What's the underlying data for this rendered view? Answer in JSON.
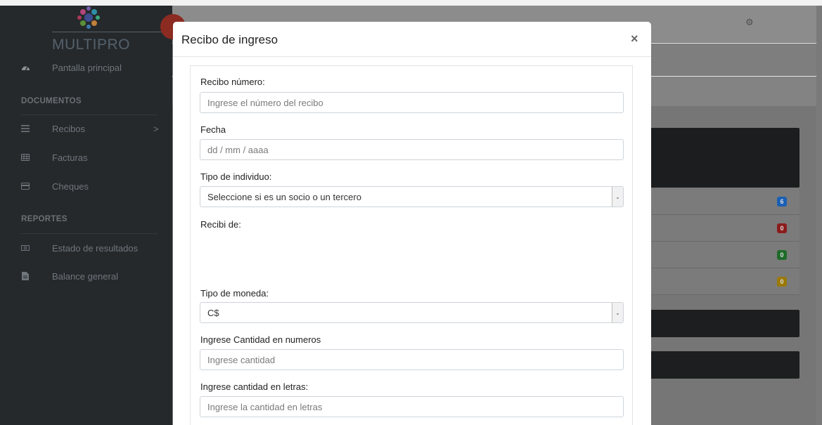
{
  "app": {
    "brand_name": "MULTIPRO"
  },
  "sidebar": {
    "home": {
      "label": "Pantalla principal",
      "icon": "dashboard-icon"
    },
    "sections": [
      {
        "title": "DOCUMENTOS",
        "items": [
          {
            "label": "Recibos",
            "icon": "list-icon",
            "chevron": ">"
          },
          {
            "label": "Facturas",
            "icon": "table-icon"
          },
          {
            "label": "Cheques",
            "icon": "credit-card-icon"
          }
        ]
      },
      {
        "title": "REPORTES",
        "items": [
          {
            "label": "Estado de resultados",
            "icon": "money-icon"
          },
          {
            "label": "Balance general",
            "icon": "file-icon"
          }
        ]
      }
    ]
  },
  "background": {
    "badges": [
      {
        "value": "6",
        "color": "#1a5fb4"
      },
      {
        "value": "0",
        "color": "#8b1c1c"
      },
      {
        "value": "0",
        "color": "#1f6b2a"
      },
      {
        "value": "0",
        "color": "#9a7a06"
      }
    ]
  },
  "modal": {
    "title": "Recibo de ingreso",
    "close": "×",
    "fields": {
      "receipt_number": {
        "label": "Recibo número:",
        "placeholder": "Ingrese el número del recibo"
      },
      "date": {
        "label": "Fecha",
        "placeholder": "dd / mm / aaaa"
      },
      "individual_type": {
        "label": "Tipo de individuo:",
        "value": "Seleccione si es un socio o un tercero"
      },
      "received_from": {
        "label": "Recibi de:"
      },
      "currency": {
        "label": "Tipo de moneda:",
        "value": "C$"
      },
      "amount_numbers": {
        "label": "Ingrese Cantidad en numeros",
        "placeholder": "Ingrese cantidad"
      },
      "amount_letters": {
        "label": "Ingrese cantidad en letras:",
        "placeholder": "Ingrese la cantidad en letras"
      }
    }
  },
  "colors": {
    "sidebar_bg": "#25292c",
    "toggle_accent": "#8c2b22"
  }
}
